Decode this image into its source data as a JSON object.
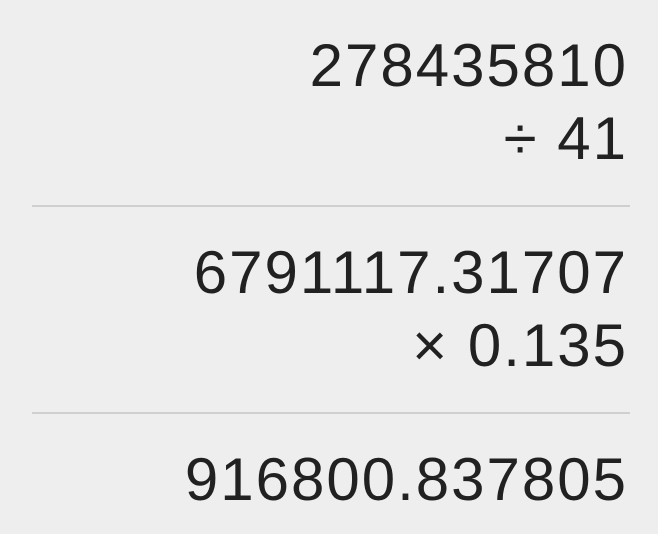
{
  "history": {
    "entry1": {
      "operand": "278435810",
      "operation": "÷ 41"
    },
    "entry2": {
      "operand": "6791117.31707",
      "operation": "× 0.135"
    },
    "result": "916800.837805"
  }
}
